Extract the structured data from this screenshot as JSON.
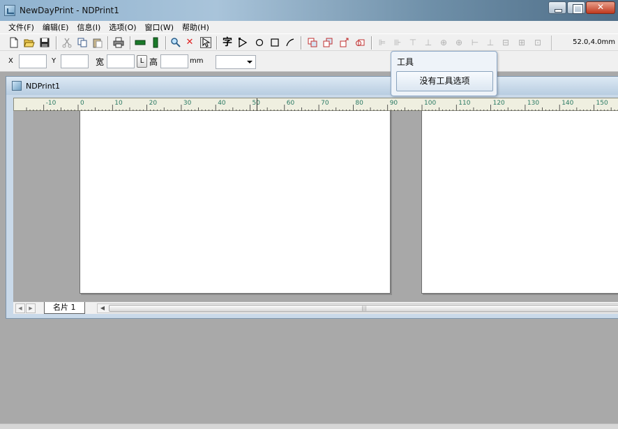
{
  "window": {
    "title": "NewDayPrint - NDPrint1"
  },
  "menu": [
    "文件(F)",
    "编辑(E)",
    "信息(I)",
    "选项(O)",
    "窗口(W)",
    "帮助(H)"
  ],
  "toolbar": {
    "coordinates": "52.0,4.0mm",
    "text_tool_glyph": "字"
  },
  "props_bar": {
    "x_label": "X",
    "y_label": "Y",
    "width_label": "宽",
    "lock_label": "L",
    "height_label": "高",
    "unit_label": "mm",
    "x_value": "",
    "y_value": "",
    "width_value": "",
    "height_value": "",
    "combo_value": ""
  },
  "tool_popup": {
    "title": "工具",
    "button_label": "没有工具选项"
  },
  "document": {
    "title": "NDPrint1",
    "sheet_tab": "名片 1",
    "ruler_labels": [
      "-10",
      "0",
      "10",
      "20",
      "30",
      "40",
      "50",
      "60",
      "70",
      "80",
      "90",
      "100",
      "110",
      "120",
      "130",
      "140",
      "150"
    ]
  },
  "colors": {
    "ruler_text": "#2a7a63",
    "workspace": "#a8a8a8",
    "page": "#ffffff"
  }
}
